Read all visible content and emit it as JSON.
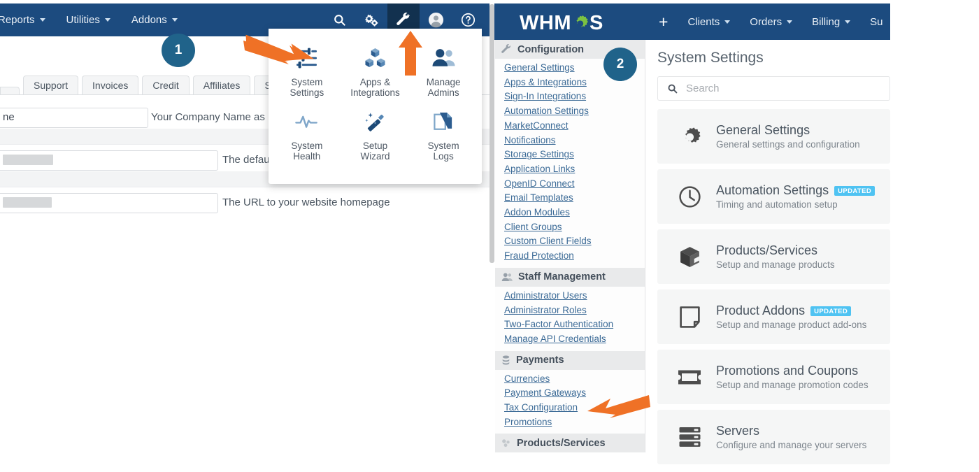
{
  "left_panel": {
    "nav_items": [
      {
        "label": "Reports",
        "caret": true
      },
      {
        "label": "Utilities",
        "caret": true
      },
      {
        "label": "Addons",
        "caret": true
      }
    ],
    "top_icons": [
      {
        "name": "search-icon",
        "active": false
      },
      {
        "name": "gears-icon",
        "active": false
      },
      {
        "name": "wrench-icon",
        "active": true
      },
      {
        "name": "user-avatar-icon",
        "active": false
      },
      {
        "name": "help-circle-icon",
        "active": false
      }
    ],
    "tabs": [
      "Support",
      "Invoices",
      "Credit",
      "Affiliates",
      "Securi"
    ],
    "form_rows": [
      {
        "value": "ne",
        "help": "Your Company Name as"
      },
      {
        "value": "",
        "help": "The defau"
      },
      {
        "value": "",
        "help": "The URL to your website homepage"
      }
    ],
    "dropdown": {
      "items": [
        {
          "label": "System\nSettings",
          "icon": "sliders-icon"
        },
        {
          "label": "Apps &\nIntegrations",
          "icon": "apps-cubes-icon"
        },
        {
          "label": "Manage\nAdmins",
          "icon": "users-icon"
        },
        {
          "label": "System\nHealth",
          "icon": "heartbeat-icon"
        },
        {
          "label": "Setup\nWizard",
          "icon": "magic-wand-icon"
        },
        {
          "label": "System\nLogs",
          "icon": "documents-icon"
        }
      ]
    }
  },
  "right_panel": {
    "logo": "WHMCS",
    "nav_items": [
      {
        "label": "Clients",
        "caret": true
      },
      {
        "label": "Orders",
        "caret": true
      },
      {
        "label": "Billing",
        "caret": true
      },
      {
        "label": "Su",
        "caret": false
      }
    ],
    "plus_label": "+",
    "sidebar": {
      "sections": [
        {
          "title": "Configuration",
          "icon": "wrench-icon",
          "links": [
            "General Settings",
            "Apps & Integrations",
            "Sign-In Integrations",
            "Automation Settings",
            "MarketConnect",
            "Notifications",
            "Storage Settings",
            "Application Links",
            "OpenID Connect",
            "Email Templates",
            "Addon Modules",
            "Client Groups",
            "Custom Client Fields",
            "Fraud Protection"
          ]
        },
        {
          "title": "Staff Management",
          "icon": "users-icon",
          "links": [
            "Administrator Users",
            "Administrator Roles",
            "Two-Factor Authentication",
            "Manage API Credentials"
          ]
        },
        {
          "title": "Payments",
          "icon": "money-icon",
          "links": [
            "Currencies",
            "Payment Gateways",
            "Tax Configuration",
            "Promotions"
          ]
        },
        {
          "title": "Products/Services",
          "icon": "boxes-icon",
          "links": []
        }
      ]
    },
    "main": {
      "title": "System Settings",
      "search_placeholder": "Search",
      "cards": [
        {
          "title": "General Settings",
          "subtitle": "General settings and configuration",
          "badge": "",
          "icon": "gear-icon"
        },
        {
          "title": "Automation Settings",
          "subtitle": "Timing and automation setup",
          "badge": "UPDATED",
          "icon": "clock-icon"
        },
        {
          "title": "Products/Services",
          "subtitle": "Setup and manage products",
          "badge": "",
          "icon": "cube-icon"
        },
        {
          "title": "Product Addons",
          "subtitle": "Setup and manage product add-ons",
          "badge": "UPDATED",
          "icon": "page-icon"
        },
        {
          "title": "Promotions and Coupons",
          "subtitle": "Setup and manage promotion codes",
          "badge": "",
          "icon": "ticket-icon"
        },
        {
          "title": "Servers",
          "subtitle": "Configure and manage your servers",
          "badge": "",
          "icon": "server-icon"
        }
      ]
    }
  },
  "annotations": {
    "step_badges": [
      {
        "label": "1",
        "color": "#20638a"
      },
      {
        "label": "2",
        "color": "#20638a"
      }
    ],
    "arrow_color": "#ef7126",
    "arrows": [
      {
        "name": "arrow-to-system-settings"
      },
      {
        "name": "arrow-to-wrench-icon"
      },
      {
        "name": "arrow-to-payment-gateways"
      }
    ]
  },
  "colors": {
    "navbar": "#1c4b7f",
    "navbar_active": "#12314f",
    "link": "#3b6a96",
    "badge_updated": "#4fc3f2",
    "accent_orange": "#ef7126",
    "step_badge": "#20638a"
  }
}
